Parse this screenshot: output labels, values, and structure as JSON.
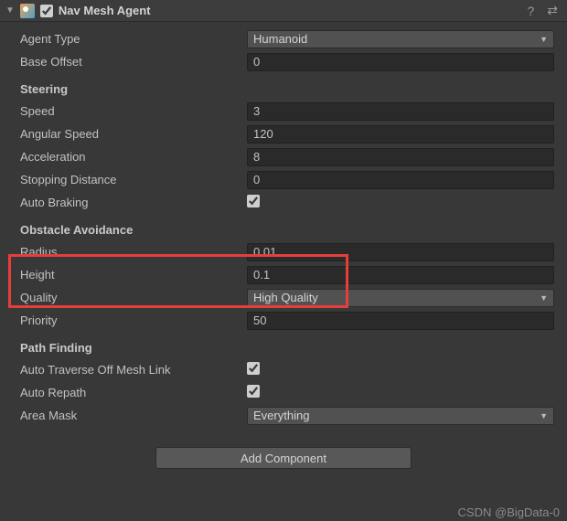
{
  "header": {
    "title": "Nav Mesh Agent",
    "enabled": true
  },
  "fields": {
    "agent_type": {
      "label": "Agent Type",
      "value": "Humanoid"
    },
    "base_offset": {
      "label": "Base Offset",
      "value": "0"
    }
  },
  "steering": {
    "title": "Steering",
    "speed": {
      "label": "Speed",
      "value": "3"
    },
    "angular_speed": {
      "label": "Angular Speed",
      "value": "120"
    },
    "acceleration": {
      "label": "Acceleration",
      "value": "8"
    },
    "stopping_distance": {
      "label": "Stopping Distance",
      "value": "0"
    },
    "auto_braking": {
      "label": "Auto Braking",
      "checked": true
    }
  },
  "obstacle": {
    "title": "Obstacle Avoidance",
    "radius": {
      "label": "Radius",
      "value": "0.01"
    },
    "height": {
      "label": "Height",
      "value": "0.1"
    },
    "quality": {
      "label": "Quality",
      "value": "High Quality"
    },
    "priority": {
      "label": "Priority",
      "value": "50"
    }
  },
  "path": {
    "title": "Path Finding",
    "auto_traverse": {
      "label": "Auto Traverse Off Mesh Link",
      "checked": true
    },
    "auto_repath": {
      "label": "Auto Repath",
      "checked": true
    },
    "area_mask": {
      "label": "Area Mask",
      "value": "Everything"
    }
  },
  "add_component": "Add Component",
  "watermark": "CSDN @BigData-0"
}
